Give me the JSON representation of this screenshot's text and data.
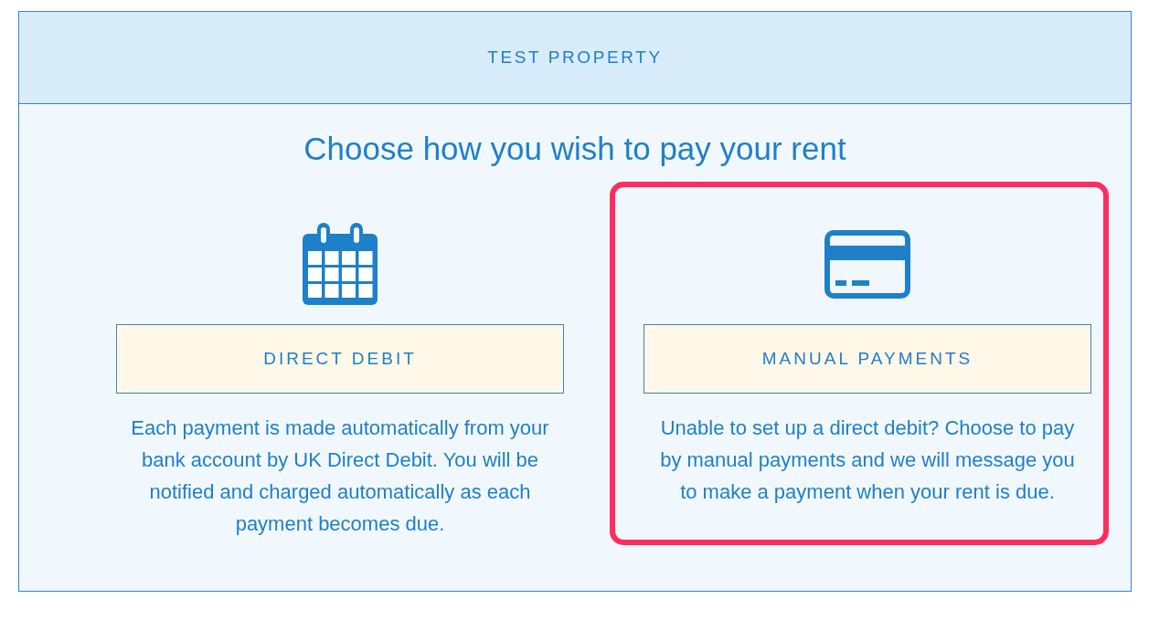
{
  "header": {
    "title": "TEST PROPERTY"
  },
  "heading": "Choose how you wish to pay your rent",
  "options": [
    {
      "kind": "calendar",
      "button": "DIRECT DEBIT",
      "description": "Each payment is made automatically from your bank account by UK Direct Debit. You will be notified and charged automatically as each payment becomes due.",
      "highlighted": false
    },
    {
      "kind": "card",
      "button": "MANUAL PAYMENTS",
      "description": "Unable to set up a direct debit? Choose to pay by manual payments and we will message you to make a payment when your rent is due.",
      "highlighted": true
    }
  ]
}
